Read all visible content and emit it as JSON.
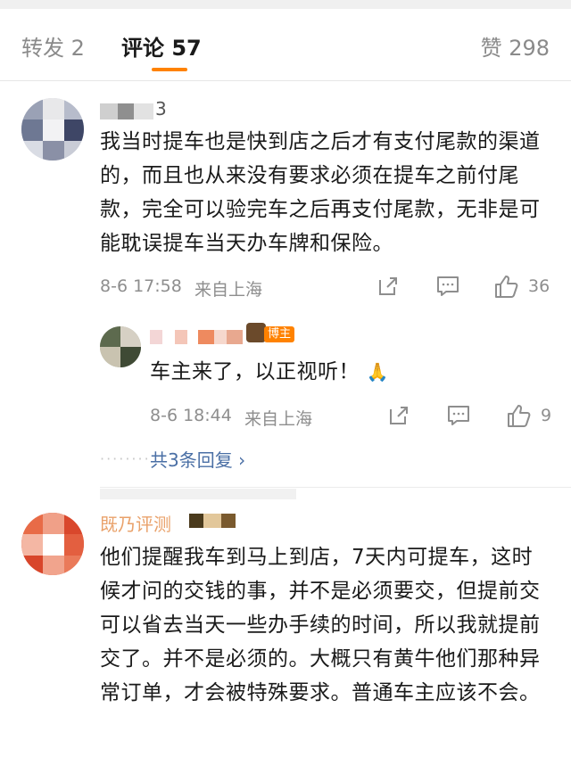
{
  "tabs": {
    "repost": "转发 2",
    "comments": "评论 57",
    "likes": "赞 298"
  },
  "comments": [
    {
      "username_partial": "3",
      "text": "我当时提车也是快到店之后才有支付尾款的渠道的，而且也从来没有要求必须在提车之前付尾款，完全可以验完车之后再支付尾款，无非是可能耽误提车当天办车牌和保险。",
      "timestamp": "8-6 17:58",
      "location": "来自上海",
      "like_count": "36"
    },
    {
      "username_partial": "既乃评测",
      "text": "他们提醒我车到马上到店，7天内可提车，这时候才问的交钱的事，并不是必须要交，但提前交可以省去当天一些办手续的时间，所以我就提前交了。并不是必须的。大概只有黄牛他们那种异常订单，才会被特殊要求。普通车主应该不会。"
    }
  ],
  "reply": {
    "badge": "博主",
    "text": "车主来了，以正视听！",
    "emoji": "🙏",
    "timestamp": "8-6 18:44",
    "location": "来自上海",
    "like_count": "9",
    "more_replies": "共3条回复 ›"
  },
  "colors": {
    "accent": "#ff8200",
    "link": "#4a6fa5",
    "muted": "#8e8e8e"
  }
}
